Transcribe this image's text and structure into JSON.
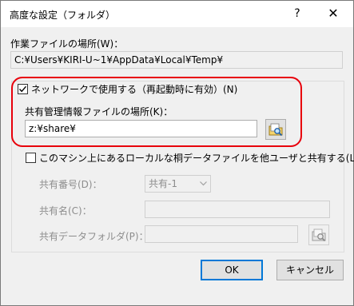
{
  "window": {
    "title": "高度な設定（フォルダ）",
    "help_label": "?",
    "close_label": "✕"
  },
  "workplace": {
    "label": "作業ファイルの場所(W)：",
    "value": "C:¥Users¥KIRI-U~1¥AppData¥Local¥Temp¥"
  },
  "network": {
    "checkbox_label": "ネットワークで使用する（再起動時に有効）(N)",
    "checked": true,
    "shared_info_label": "共有管理情報ファイルの場所(K)：",
    "shared_info_value": "z:¥share¥"
  },
  "local_share": {
    "checkbox_label": "このマシン上にあるローカルな桐データファイルを他ユーザと共有する(L)",
    "checked": false,
    "number_label": "共有番号(D)：",
    "number_value": "共有-1",
    "name_label": "共有名(C)：",
    "name_value": "",
    "folder_label": "共有データフォルダ(P)：",
    "folder_value": ""
  },
  "buttons": {
    "ok": "OK",
    "cancel": "キャンセル"
  },
  "icons": {
    "browse": "folder-search-icon",
    "dropdown": "chevron-down-icon",
    "check": "check-icon"
  },
  "colors": {
    "highlight_frame": "#e8000b",
    "default_button_border": "#0078d7"
  }
}
